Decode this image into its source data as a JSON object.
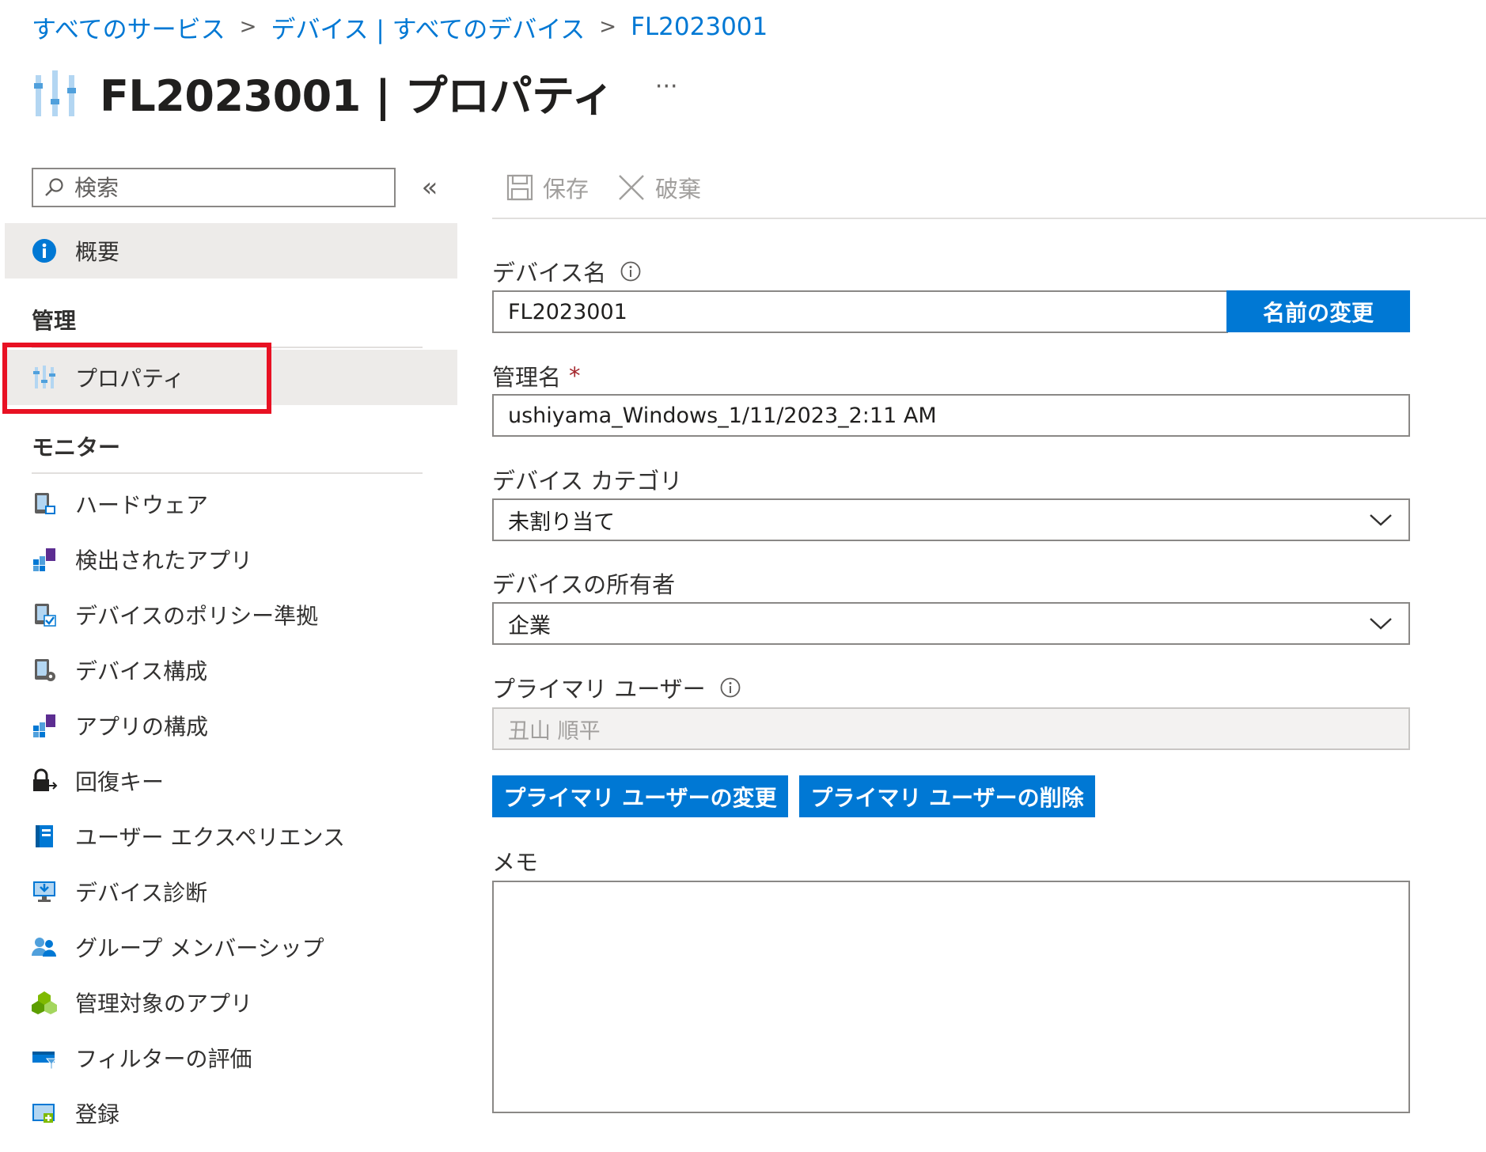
{
  "breadcrumb": {
    "items": [
      "すべてのサービス",
      "デバイス | すべてのデバイス",
      "FL2023001"
    ],
    "separator": ">"
  },
  "header": {
    "title": "FL2023001 | プロパティ",
    "more": "···",
    "icon": "properties-sliders-icon"
  },
  "sidebar": {
    "search_placeholder": "検索",
    "collapse": "«",
    "overview": {
      "label": "概要",
      "icon": "info-icon"
    },
    "section_manage": "管理",
    "properties": {
      "label": "プロパティ",
      "icon": "properties-sliders-icon"
    },
    "section_monitor": "モニター",
    "items": [
      {
        "label": "ハードウェア",
        "icon": "hardware-icon"
      },
      {
        "label": "検出されたアプリ",
        "icon": "discovered-apps-icon"
      },
      {
        "label": "デバイスのポリシー準拠",
        "icon": "device-compliance-icon"
      },
      {
        "label": "デバイス構成",
        "icon": "device-configuration-icon"
      },
      {
        "label": "アプリの構成",
        "icon": "app-configuration-icon"
      },
      {
        "label": "回復キー",
        "icon": "recovery-key-icon"
      },
      {
        "label": "ユーザー エクスペリエンス",
        "icon": "user-experience-icon"
      },
      {
        "label": "デバイス診断",
        "icon": "device-diagnostics-icon"
      },
      {
        "label": "グループ メンバーシップ",
        "icon": "group-membership-icon"
      },
      {
        "label": "管理対象のアプリ",
        "icon": "managed-apps-icon"
      },
      {
        "label": "フィルターの評価",
        "icon": "filter-evaluation-icon"
      },
      {
        "label": "登録",
        "icon": "enrollment-icon"
      }
    ]
  },
  "toolbar": {
    "save_label": "保存",
    "discard_label": "破棄"
  },
  "form": {
    "device_name": {
      "label": "デバイス名",
      "value": "FL2023001",
      "rename_button": "名前の変更"
    },
    "management_name": {
      "label": "管理名",
      "required_mark": "*",
      "value": "ushiyama_Windows_1/11/2023_2:11 AM"
    },
    "device_category": {
      "label": "デバイス カテゴリ",
      "value": "未割り当て"
    },
    "device_owner": {
      "label": "デバイスの所有者",
      "value": "企業"
    },
    "primary_user": {
      "label": "プライマリ ユーザー",
      "value": "丑山 順平"
    },
    "change_primary_user": "プライマリ ユーザーの変更",
    "remove_primary_user": "プライマリ ユーザーの削除",
    "memo": {
      "label": "メモ",
      "value": ""
    }
  },
  "colors": {
    "accent": "#0078d4",
    "highlight": "#e81123",
    "selected_bg": "#edebe9"
  }
}
